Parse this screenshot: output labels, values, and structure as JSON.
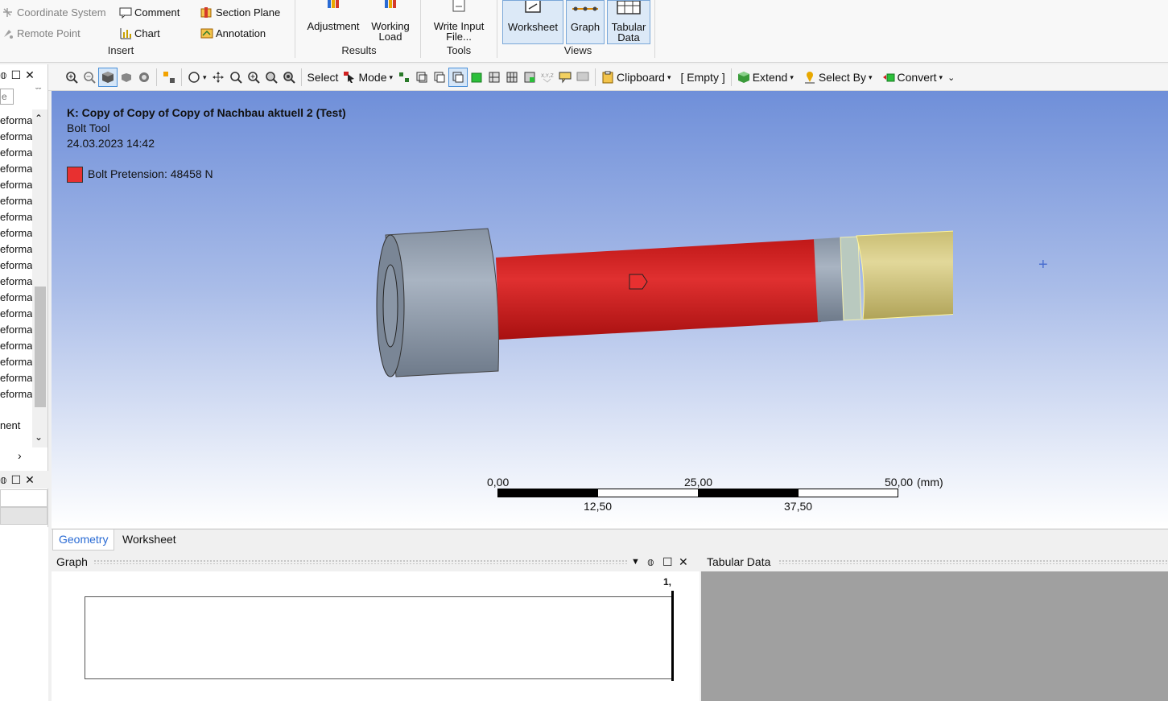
{
  "ribbon": {
    "insert": {
      "coordinate_system": "Coordinate System",
      "remote_point": "Remote Point",
      "comment": "Comment",
      "chart": "Chart",
      "section_plane": "Section Plane",
      "annotation": "Annotation",
      "group_label": "Insert"
    },
    "results": {
      "adjustment": "Adjustment",
      "working_load_1": "Working",
      "working_load_2": "Load",
      "group_label": "Results"
    },
    "tools": {
      "write_input_1": "Write Input",
      "write_input_2": "File...",
      "group_label": "Tools"
    },
    "views": {
      "worksheet": "Worksheet",
      "graph": "Graph",
      "tabular_1": "Tabular",
      "tabular_2": "Data",
      "group_label": "Views"
    }
  },
  "tree": {
    "search_placeholder": "e",
    "rows": [
      "eforma",
      "eforma",
      "eforma",
      "eforma",
      "eforma",
      "eforma",
      "eforma",
      "eforma",
      "eforma",
      "eforma",
      "eforma",
      "eforma",
      "eforma",
      "eforma",
      "eforma",
      "eforma",
      "eforma",
      "eforma"
    ],
    "bottom_row": "nent"
  },
  "toolbar": {
    "select": "Select",
    "mode": "Mode",
    "clipboard": "Clipboard",
    "empty": "[ Empty ]",
    "extend": "Extend",
    "select_by": "Select By",
    "convert": "Convert"
  },
  "viewport": {
    "title": "K: Copy of Copy of Copy of Nachbau aktuell 2 (Test)",
    "subtitle": "Bolt Tool",
    "date": "24.03.2023 14:42",
    "legend_label": "Bolt Pretension: 48458 N",
    "legend_color": "#e83030",
    "scale": {
      "top_labels": [
        "0,00",
        "25,00",
        "50,00"
      ],
      "unit": "(mm)",
      "bottom_labels": [
        "12,50",
        "37,50"
      ]
    }
  },
  "tabs": {
    "geometry": "Geometry",
    "worksheet": "Worksheet"
  },
  "graph_panel": {
    "title": "Graph",
    "marker": "1,"
  },
  "tabular_panel": {
    "title": "Tabular Data"
  }
}
